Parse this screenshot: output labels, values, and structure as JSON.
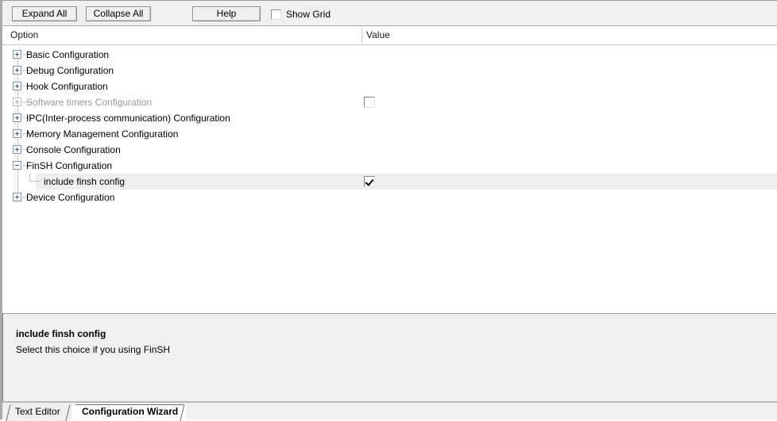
{
  "toolbar": {
    "expand_all_label": "Expand All",
    "collapse_all_label": "Collapse All",
    "help_label": "Help",
    "show_grid_label": "Show Grid",
    "show_grid_checked": false
  },
  "columns": {
    "option_header": "Option",
    "value_header": "Value"
  },
  "tree": {
    "rows": [
      {
        "label": "Basic Configuration",
        "level": 0,
        "expander": "plus",
        "disabled": false,
        "selected": false,
        "value": null
      },
      {
        "label": "Debug Configuration",
        "level": 0,
        "expander": "plus",
        "disabled": false,
        "selected": false,
        "value": null
      },
      {
        "label": "Hook Configuration",
        "level": 0,
        "expander": "plus",
        "disabled": false,
        "selected": false,
        "value": null
      },
      {
        "label": "Software timers Configuration",
        "level": 0,
        "expander": "plus",
        "disabled": true,
        "selected": false,
        "value": "unchecked"
      },
      {
        "label": "IPC(Inter-process communication) Configuration",
        "level": 0,
        "expander": "plus",
        "disabled": false,
        "selected": false,
        "value": null
      },
      {
        "label": "Memory Management Configuration",
        "level": 0,
        "expander": "plus",
        "disabled": false,
        "selected": false,
        "value": null
      },
      {
        "label": "Console Configuration",
        "level": 0,
        "expander": "plus",
        "disabled": false,
        "selected": false,
        "value": null
      },
      {
        "label": "FinSH Configuration",
        "level": 0,
        "expander": "minus",
        "disabled": false,
        "selected": false,
        "value": null
      },
      {
        "label": "include finsh config",
        "level": 1,
        "expander": "none",
        "disabled": false,
        "selected": true,
        "value": "checked"
      },
      {
        "label": "Device Configuration",
        "level": 0,
        "expander": "plus",
        "disabled": false,
        "selected": false,
        "value": null
      }
    ]
  },
  "description": {
    "title": "include finsh config",
    "body": "Select this choice if you using FinSH"
  },
  "tabs": {
    "items": [
      {
        "label": "Text Editor",
        "active": false
      },
      {
        "label": "Configuration Wizard",
        "active": true
      }
    ]
  },
  "colors": {
    "window_bg": "#f0f0f0",
    "pane_bg": "#ffffff",
    "selection_bg": "#efefef",
    "disabled_text": "#9a9a9a",
    "tree_line": "#9b9b9b"
  }
}
